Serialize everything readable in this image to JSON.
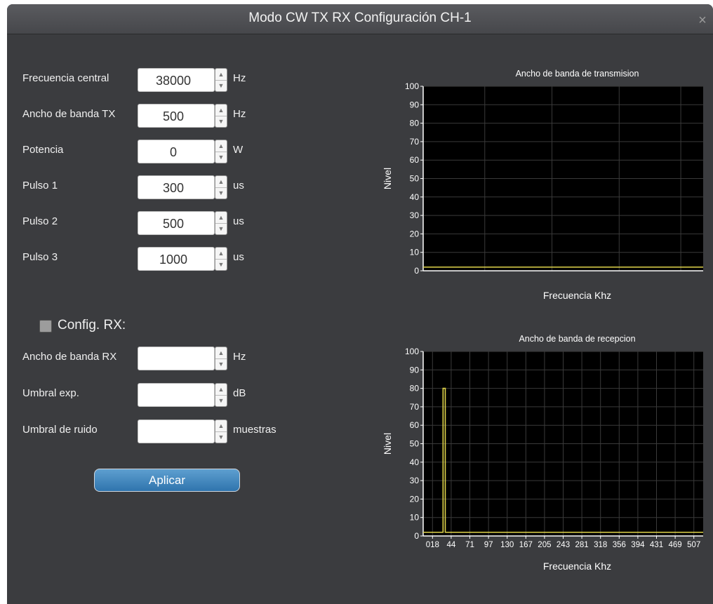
{
  "window": {
    "title": "Modo CW TX RX Configuración CH-1",
    "close_icon": "×"
  },
  "tx_fields": [
    {
      "label": "Frecuencia central",
      "value": "38000",
      "unit": "Hz"
    },
    {
      "label": "Ancho de banda TX",
      "value": "500",
      "unit": "Hz"
    },
    {
      "label": "Potencia",
      "value": "0",
      "unit": "W"
    },
    {
      "label": "Pulso 1",
      "value": "300",
      "unit": "us"
    },
    {
      "label": "Pulso 2",
      "value": "500",
      "unit": "us"
    },
    {
      "label": "Pulso 3",
      "value": "1000",
      "unit": "us"
    }
  ],
  "rx": {
    "checkbox_label": "Config. RX:",
    "checked": false,
    "fields": [
      {
        "label": "Ancho de banda RX",
        "value": "",
        "unit": "Hz"
      },
      {
        "label": "Umbral exp.",
        "value": "",
        "unit": "dB"
      },
      {
        "label": "Umbral de ruido",
        "value": "",
        "unit": "muestras"
      }
    ]
  },
  "apply_button": "Aplicar",
  "colors": {
    "background": "#3b3c3f",
    "trace": "#e0d44a",
    "button": "#3a82bd"
  },
  "chart_data": [
    {
      "type": "line",
      "title": "Ancho de banda de transmision",
      "xlabel": "Frecuencia Khz",
      "ylabel": "Nivel",
      "ylim": [
        0,
        100
      ],
      "yticks": [
        "0",
        "10",
        "20",
        "30",
        "40",
        "50",
        "60",
        "70",
        "80",
        "90",
        "100"
      ],
      "xticks": [],
      "grid": true,
      "series": [
        {
          "values": [
            2,
            2
          ]
        }
      ]
    },
    {
      "type": "line",
      "title": "Ancho de banda de recepcion",
      "xlabel": "Frecuencia Khz",
      "ylabel": "Nivel",
      "ylim": [
        0,
        100
      ],
      "yticks": [
        "0",
        "10",
        "20",
        "30",
        "40",
        "50",
        "60",
        "70",
        "80",
        "90",
        "100"
      ],
      "xticks": [
        "018",
        "44",
        "71",
        "97",
        "130",
        "167",
        "205",
        "243",
        "281",
        "318",
        "356",
        "394",
        "431",
        "469",
        "507"
      ],
      "grid": true,
      "series": [
        {
          "x": [
            0,
            36,
            36,
            40,
            40,
            507
          ],
          "values": [
            2,
            2,
            80,
            80,
            2,
            2
          ]
        }
      ]
    }
  ]
}
